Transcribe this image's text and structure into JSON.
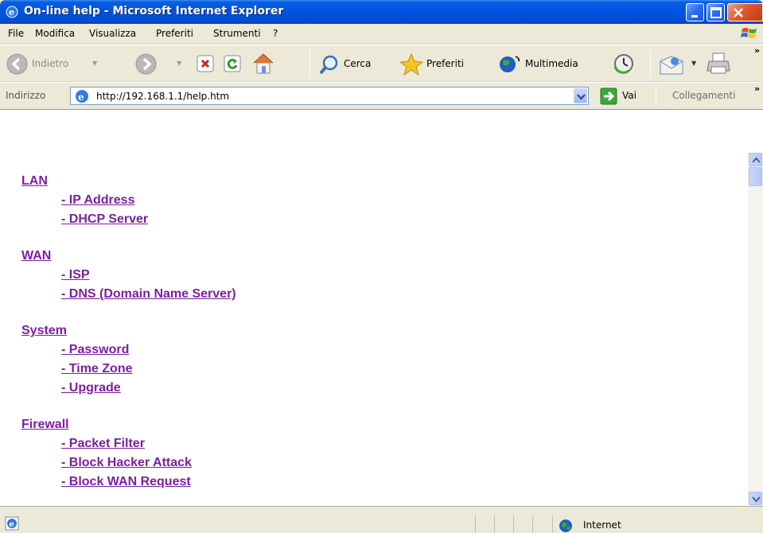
{
  "window": {
    "title": "On-line help - Microsoft Internet Explorer"
  },
  "menu": {
    "items": [
      "File",
      "Modifica",
      "Visualizza",
      "Preferiti",
      "Strumenti",
      "?"
    ]
  },
  "toolbar": {
    "back_label": "Indietro",
    "search_label": "Cerca",
    "favorites_label": "Preferiti",
    "media_label": "Multimedia",
    "overflow": "»"
  },
  "address": {
    "label": "Indirizzo",
    "url": "http://192.168.1.1/help.htm",
    "go_label": "Vai",
    "links_label": "Collegamenti",
    "overflow": "»"
  },
  "content": {
    "sections": [
      {
        "title": "LAN",
        "items": [
          "- IP Address",
          "- DHCP Server"
        ]
      },
      {
        "title": "WAN",
        "items": [
          "- ISP",
          "- DNS (Domain Name Server)"
        ]
      },
      {
        "title": "System",
        "items": [
          "- Password",
          "- Time Zone",
          "- Upgrade"
        ]
      },
      {
        "title": "Firewall",
        "items": [
          "- Packet Filter",
          "- Block Hacker Attack",
          "- Block WAN Request"
        ]
      }
    ],
    "link_color": "#7b1fa2"
  },
  "status": {
    "zone": "Internet"
  }
}
